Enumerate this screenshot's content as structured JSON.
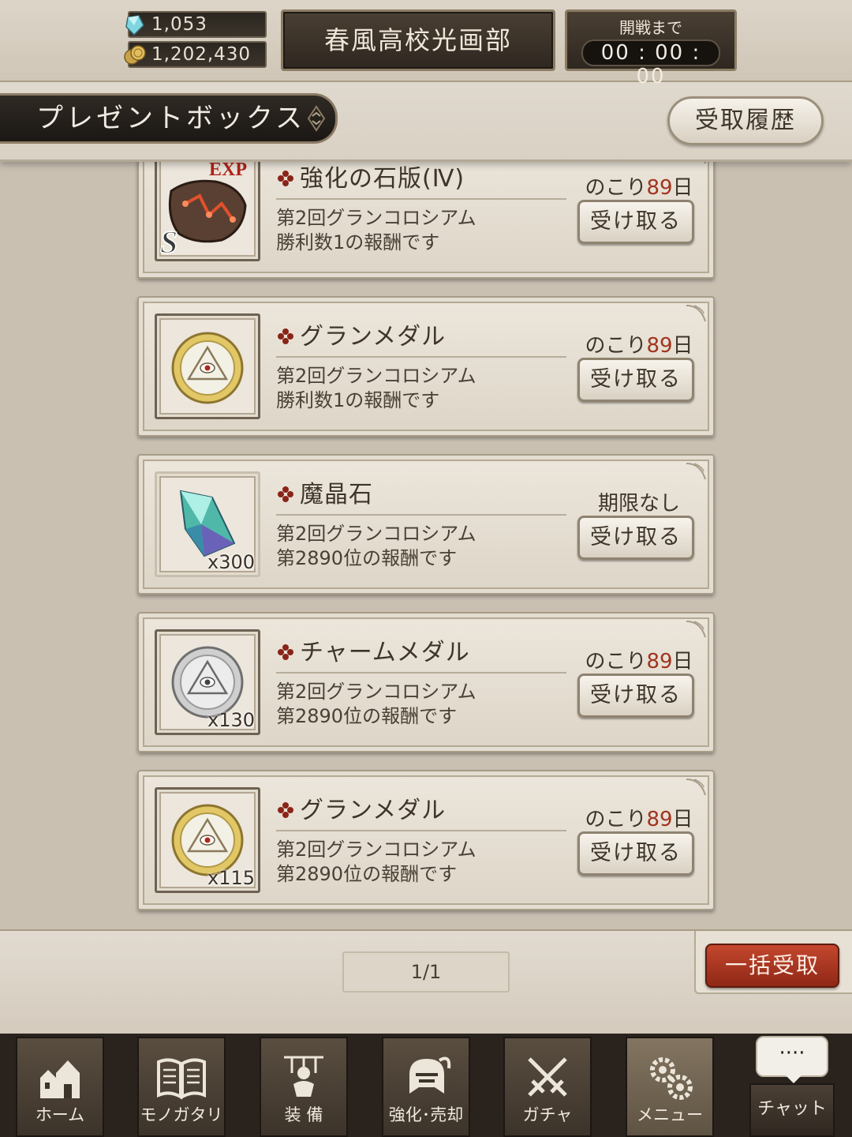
{
  "header": {
    "gems": "1,053",
    "coins": "1,202,430",
    "club_name": "春風高校光画部",
    "timer_label": "開戦まで",
    "timer_value": "00 : 00 : 00",
    "page_title": "プレゼントボックス",
    "history_button": "受取履歴"
  },
  "presents": [
    {
      "name": "強化の石版(Ⅳ)",
      "line1": "第2回グランコロシアム",
      "line2": "勝利数1の報酬です",
      "remaining_prefix": "のこり",
      "remaining_days": "89",
      "remaining_suffix": "日",
      "receive": "受け取る",
      "qty": "",
      "rank": "S",
      "badge": "EXP",
      "icon": "exp-stone-tablet-icon"
    },
    {
      "name": "グランメダル",
      "line1": "第2回グランコロシアム",
      "line2": "勝利数1の報酬です",
      "remaining_prefix": "のこり",
      "remaining_days": "89",
      "remaining_suffix": "日",
      "receive": "受け取る",
      "qty": "",
      "icon": "gold-medal-icon"
    },
    {
      "name": "魔晶石",
      "line1": "第2回グランコロシアム",
      "line2": "第2890位の報酬です",
      "remaining_prefix": "",
      "remaining_days": "",
      "remaining_suffix": "期限なし",
      "receive": "受け取る",
      "qty": "x300",
      "icon": "magic-crystal-icon"
    },
    {
      "name": "チャームメダル",
      "line1": "第2回グランコロシアム",
      "line2": "第2890位の報酬です",
      "remaining_prefix": "のこり",
      "remaining_days": "89",
      "remaining_suffix": "日",
      "receive": "受け取る",
      "qty": "x130",
      "icon": "silver-medal-icon"
    },
    {
      "name": "グランメダル",
      "line1": "第2回グランコロシアム",
      "line2": "第2890位の報酬です",
      "remaining_prefix": "のこり",
      "remaining_days": "89",
      "remaining_suffix": "日",
      "receive": "受け取る",
      "qty": "x115",
      "icon": "gold-medal-icon"
    }
  ],
  "footer": {
    "pager": "1/1",
    "claim_all": "一括受取"
  },
  "nav": {
    "home": "ホーム",
    "story": "モノガタリ",
    "equip": "装 備",
    "enhance": "強化･売却",
    "gacha": "ガチャ",
    "menu": "メニュー",
    "chat": "チャット",
    "chat_bubble": "····"
  },
  "colors": {
    "accent_red": "#a0341f",
    "claim_all_bg": "#b03b24",
    "dark_plate": "#2e2720"
  }
}
